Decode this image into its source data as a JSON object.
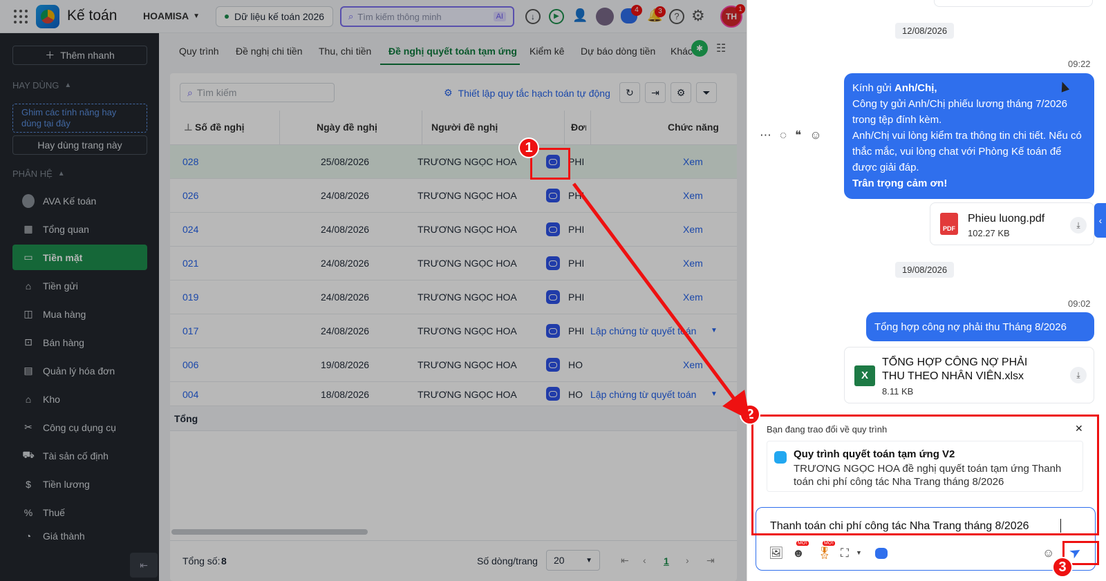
{
  "topbar": {
    "app_title": "Kế toán",
    "company": "HOAMISA",
    "dataset": "Dữ liệu kế toán 2026",
    "search_placeholder": "Tìm kiếm thông minh",
    "ai_label": "AI",
    "chat_badge": "4",
    "notif_badge": "3",
    "avatar_initials": "TH",
    "avatar_badge": "1"
  },
  "sidebar": {
    "quick_add": "Thêm nhanh",
    "frequent_header": "HAY DÙNG",
    "pin_hint": "Ghim các tính năng hay dùng tại đây",
    "use_page": "Hay dùng trang này",
    "modules_header": "PHÂN HỆ",
    "items": [
      {
        "label": "AVA Kế toán"
      },
      {
        "label": "Tổng quan"
      },
      {
        "label": "Tiền mặt"
      },
      {
        "label": "Tiền gửi"
      },
      {
        "label": "Mua hàng"
      },
      {
        "label": "Bán hàng"
      },
      {
        "label": "Quản lý hóa đơn"
      },
      {
        "label": "Kho"
      },
      {
        "label": "Công cụ dụng cụ"
      },
      {
        "label": "Tài sản cố định"
      },
      {
        "label": "Tiền lương"
      },
      {
        "label": "Thuế"
      },
      {
        "label": "Giá thành"
      }
    ]
  },
  "tabs": [
    "Quy trình",
    "Đề nghị chi tiền",
    "Thu, chi tiền",
    "Đề nghị quyết toán tạm ứng",
    "Kiểm kê",
    "Dự báo dòng tiền",
    "Khác"
  ],
  "toolbar": {
    "search_placeholder": "Tìm kiếm",
    "auto_rule": "Thiết lập quy tắc hạch toán tự động"
  },
  "table": {
    "headers": [
      "Số đề nghị",
      "Ngày đề nghị",
      "Người đề nghị",
      "Đơn",
      "Chức năng"
    ],
    "rows": [
      {
        "no": "028",
        "date": "25/08/2026",
        "person": "TRƯƠNG NGỌC HOA",
        "unit": "PHI",
        "action": "Xem"
      },
      {
        "no": "026",
        "date": "24/08/2026",
        "person": "TRƯƠNG NGỌC HOA",
        "unit": "PHI",
        "action": "Xem"
      },
      {
        "no": "024",
        "date": "24/08/2026",
        "person": "TRƯƠNG NGỌC HOA",
        "unit": "PHI",
        "action": "Xem"
      },
      {
        "no": "021",
        "date": "24/08/2026",
        "person": "TRƯƠNG NGỌC HOA",
        "unit": "PHI",
        "action": "Xem"
      },
      {
        "no": "019",
        "date": "24/08/2026",
        "person": "TRƯƠNG NGỌC HOA",
        "unit": "PHI",
        "action": "Xem"
      },
      {
        "no": "017",
        "date": "24/08/2026",
        "person": "TRƯƠNG NGỌC HOA",
        "unit": "PHI",
        "action": "Lập chứng từ quyết toán"
      },
      {
        "no": "006",
        "date": "19/08/2026",
        "person": "TRƯƠNG NGỌC HOA",
        "unit": "HO",
        "action": "Xem"
      },
      {
        "no": "004",
        "date": "18/08/2026",
        "person": "TRƯƠNG NGỌC HOA",
        "unit": "HO",
        "action": "Lập chứng từ quyết toán"
      }
    ],
    "total_label": "Tổng"
  },
  "footer": {
    "total_label": "Tổng số:",
    "total_value": "8",
    "rows_per_page_label": "Số dòng/trang",
    "rows_per_page": "20",
    "current_page": "1"
  },
  "chat": {
    "date1": "12/08/2026",
    "time1": "09:22",
    "msg1_greeting_prefix": "Kính gửi ",
    "msg1_greeting_bold": "Anh/Chị,",
    "msg1_line2": "Công ty gửi Anh/Chị phiếu lương tháng 7/2026 trong tệp đính kèm.",
    "msg1_line3": "Anh/Chị vui lòng kiểm tra thông tin chi tiết. Nếu có thắc mắc, vui lòng chat với Phòng Kế toán để được giải đáp.",
    "msg1_signoff": "Trân trọng cảm ơn!",
    "file1_name": "Phieu luong.pdf",
    "file1_size": "102.27 KB",
    "file1_type": "PDF",
    "date2": "19/08/2026",
    "time2": "09:02",
    "msg2": "Tổng hợp công nợ phải thu Tháng 8/2026",
    "file2_name": "TỔNG HỢP CÔNG NỢ PHẢI THU THEO NHÂN VIÊN.xlsx",
    "file2_size": "8.11 KB",
    "context_title": "Bạn đang trao đổi về quy trình",
    "context_process": "Quy trình quyết toán tạm ứng V2",
    "context_desc": "TRƯƠNG NGỌC HOA đề nghị quyết toán tạm ứng Thanh toán chi phí công tác Nha Trang tháng 8/2026",
    "input_value": "Thanh toán chi phí công tác Nha Trang tháng 8/2026",
    "new_badge": "MỚI"
  },
  "annotations": [
    "1",
    "2",
    "3"
  ],
  "colors": {
    "accent": "#2f6fed",
    "sidebar": "#23282e",
    "active_green": "#1e8f4e",
    "annotation_red": "#ee1111"
  }
}
